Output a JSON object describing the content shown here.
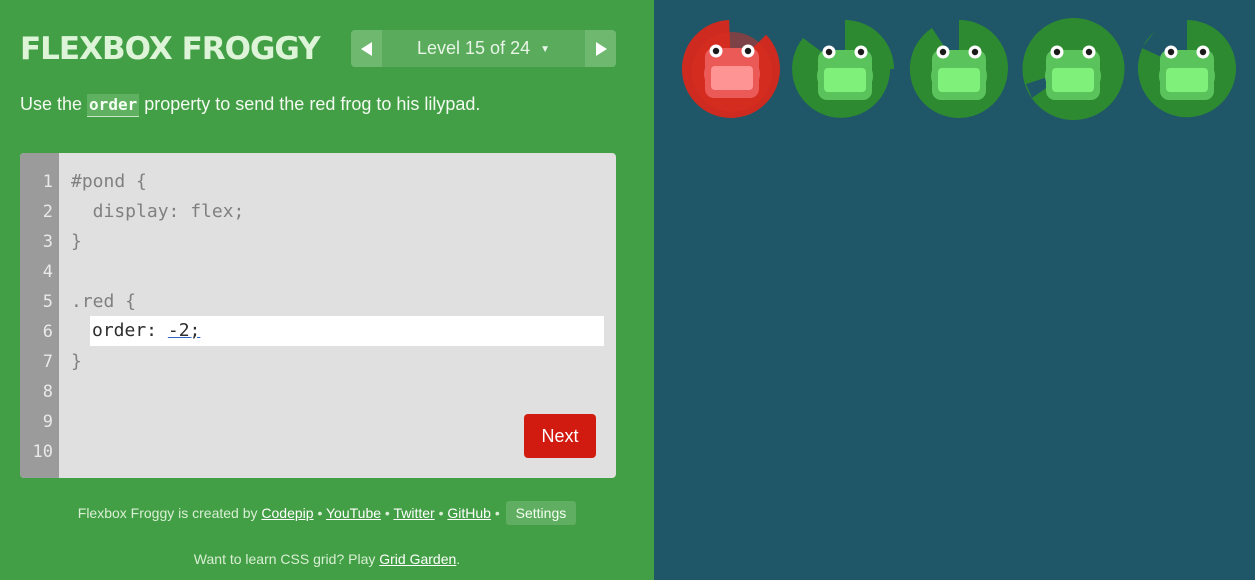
{
  "header": {
    "logo": "FLEXBOX FROGGY",
    "level_label": "Level 15 of 24",
    "caret": "▼"
  },
  "instructions": {
    "before": "Use the ",
    "code": "order",
    "after": " property to send the red frog to his lilypad."
  },
  "editor": {
    "line_numbers": [
      "1",
      "2",
      "3",
      "4",
      "5",
      "6",
      "7",
      "8",
      "9",
      "10"
    ],
    "lines": [
      "#pond {",
      "  display: flex;",
      "}",
      "",
      ".red {",
      "",
      "}"
    ],
    "input_prop": "order: ",
    "input_value": "-2;",
    "next_label": "Next"
  },
  "footer": {
    "created_by": "Flexbox Froggy is created by ",
    "links": [
      "Codepip",
      "YouTube",
      "Twitter",
      "GitHub"
    ],
    "separator": " • ",
    "settings_label": "Settings",
    "grid_before": "Want to learn CSS grid? Play ",
    "grid_link": "Grid Garden",
    "grid_after": "."
  },
  "pond": {
    "items": [
      {
        "kind": "lilypad",
        "color": "red"
      },
      {
        "kind": "lilypad",
        "color": "green"
      },
      {
        "kind": "lilypad",
        "color": "green"
      },
      {
        "kind": "lilypad",
        "color": "green"
      },
      {
        "kind": "lilypad",
        "color": "green"
      }
    ]
  },
  "colors": {
    "sidebar_bg": "#439f45",
    "pond_bg": "#1f5768",
    "next_button": "#d21b10",
    "red_frog": "#e54c4c",
    "green_frog": "#5cd35f"
  }
}
